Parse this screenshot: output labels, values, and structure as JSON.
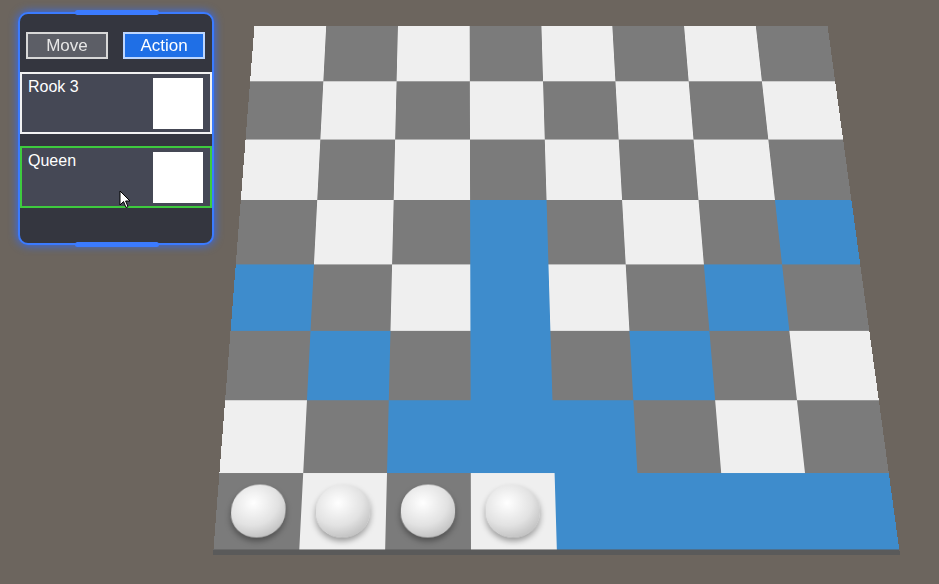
{
  "panel": {
    "tabs": [
      {
        "label": "Move",
        "selected": false
      },
      {
        "label": "Action",
        "selected": true
      }
    ],
    "units": [
      {
        "name": "Rook 3",
        "selected": true,
        "hovered": false
      },
      {
        "name": "Queen",
        "selected": false,
        "hovered": true
      }
    ]
  },
  "board": {
    "rows": [
      [
        {
          "highlighted": false,
          "piece": false
        },
        {
          "highlighted": false,
          "piece": false
        },
        {
          "highlighted": false,
          "piece": false
        },
        {
          "highlighted": false,
          "piece": false
        },
        {
          "highlighted": false,
          "piece": false
        },
        {
          "highlighted": false,
          "piece": false
        },
        {
          "highlighted": false,
          "piece": false
        },
        {
          "highlighted": false,
          "piece": false
        }
      ],
      [
        {
          "highlighted": false,
          "piece": false
        },
        {
          "highlighted": false,
          "piece": false
        },
        {
          "highlighted": false,
          "piece": false
        },
        {
          "highlighted": false,
          "piece": false
        },
        {
          "highlighted": false,
          "piece": false
        },
        {
          "highlighted": false,
          "piece": false
        },
        {
          "highlighted": false,
          "piece": false
        },
        {
          "highlighted": false,
          "piece": false
        }
      ],
      [
        {
          "highlighted": false,
          "piece": false
        },
        {
          "highlighted": false,
          "piece": false
        },
        {
          "highlighted": false,
          "piece": false
        },
        {
          "highlighted": false,
          "piece": false
        },
        {
          "highlighted": false,
          "piece": false
        },
        {
          "highlighted": false,
          "piece": false
        },
        {
          "highlighted": false,
          "piece": false
        },
        {
          "highlighted": false,
          "piece": false
        }
      ],
      [
        {
          "highlighted": false,
          "piece": false
        },
        {
          "highlighted": false,
          "piece": false
        },
        {
          "highlighted": false,
          "piece": false
        },
        {
          "highlighted": true,
          "piece": false
        },
        {
          "highlighted": false,
          "piece": false
        },
        {
          "highlighted": false,
          "piece": false
        },
        {
          "highlighted": false,
          "piece": false
        },
        {
          "highlighted": true,
          "piece": false
        }
      ],
      [
        {
          "highlighted": true,
          "piece": false
        },
        {
          "highlighted": false,
          "piece": false
        },
        {
          "highlighted": false,
          "piece": false
        },
        {
          "highlighted": true,
          "piece": false
        },
        {
          "highlighted": false,
          "piece": false
        },
        {
          "highlighted": false,
          "piece": false
        },
        {
          "highlighted": true,
          "piece": false
        },
        {
          "highlighted": false,
          "piece": false
        }
      ],
      [
        {
          "highlighted": false,
          "piece": false
        },
        {
          "highlighted": true,
          "piece": false
        },
        {
          "highlighted": false,
          "piece": false
        },
        {
          "highlighted": true,
          "piece": false
        },
        {
          "highlighted": false,
          "piece": false
        },
        {
          "highlighted": true,
          "piece": false
        },
        {
          "highlighted": false,
          "piece": false
        },
        {
          "highlighted": false,
          "piece": false
        }
      ],
      [
        {
          "highlighted": false,
          "piece": false
        },
        {
          "highlighted": false,
          "piece": false
        },
        {
          "highlighted": true,
          "piece": false
        },
        {
          "highlighted": true,
          "piece": false
        },
        {
          "highlighted": true,
          "piece": false
        },
        {
          "highlighted": false,
          "piece": false
        },
        {
          "highlighted": false,
          "piece": false
        },
        {
          "highlighted": false,
          "piece": false
        }
      ],
      [
        {
          "highlighted": false,
          "piece": true
        },
        {
          "highlighted": false,
          "piece": true
        },
        {
          "highlighted": false,
          "piece": true
        },
        {
          "highlighted": false,
          "piece": true
        },
        {
          "highlighted": true,
          "piece": false
        },
        {
          "highlighted": true,
          "piece": false
        },
        {
          "highlighted": true,
          "piece": false
        },
        {
          "highlighted": true,
          "piece": false
        }
      ]
    ]
  }
}
